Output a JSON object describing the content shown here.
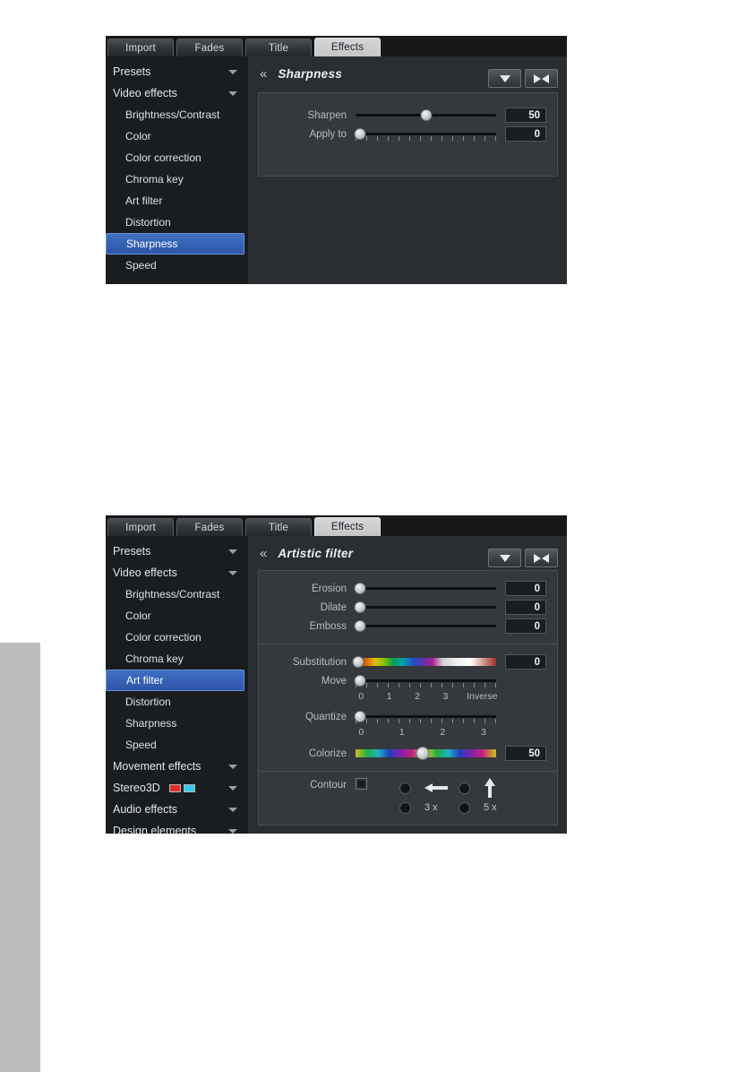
{
  "tabs": [
    {
      "label": "Import",
      "active": false
    },
    {
      "label": "Fades",
      "active": false
    },
    {
      "label": "Title",
      "active": false
    },
    {
      "label": "Effects",
      "active": true
    }
  ],
  "sidebar_sharpness": {
    "items": [
      {
        "label": "Presets",
        "type": "group",
        "caret": true
      },
      {
        "label": "Video effects",
        "type": "group",
        "caret": true
      },
      {
        "label": "Brightness/Contrast",
        "type": "child"
      },
      {
        "label": "Color",
        "type": "child"
      },
      {
        "label": "Color correction",
        "type": "child"
      },
      {
        "label": "Chroma key",
        "type": "child"
      },
      {
        "label": "Art filter",
        "type": "child"
      },
      {
        "label": "Distortion",
        "type": "child"
      },
      {
        "label": "Sharpness",
        "type": "child",
        "selected": true
      },
      {
        "label": "Speed",
        "type": "child"
      }
    ]
  },
  "sidebar_artistic": {
    "items": [
      {
        "label": "Presets",
        "type": "group",
        "caret": true
      },
      {
        "label": "Video effects",
        "type": "group",
        "caret": true
      },
      {
        "label": "Brightness/Contrast",
        "type": "child"
      },
      {
        "label": "Color",
        "type": "child"
      },
      {
        "label": "Color correction",
        "type": "child"
      },
      {
        "label": "Chroma key",
        "type": "child"
      },
      {
        "label": "Art filter",
        "type": "child",
        "selected": true
      },
      {
        "label": "Distortion",
        "type": "child"
      },
      {
        "label": "Sharpness",
        "type": "child"
      },
      {
        "label": "Speed",
        "type": "child"
      },
      {
        "label": "Movement effects",
        "type": "group",
        "caret": true
      },
      {
        "label": "Stereo3D",
        "type": "group",
        "caret": true,
        "icon": "3d-glasses-icon"
      },
      {
        "label": "Audio effects",
        "type": "group",
        "caret": true
      },
      {
        "label": "Design elements",
        "type": "group",
        "caret": true
      }
    ]
  },
  "panel_sharpness": {
    "title": "Sharpness",
    "back_icon": "«",
    "buttons": {
      "dropdown_icon": "triangle-down-icon",
      "reset_icon": "reset-arrows-icon"
    },
    "controls": [
      {
        "label": "Sharpen",
        "value": "50",
        "percent": 50,
        "track": "plain"
      },
      {
        "label": "Apply to",
        "value": "0",
        "percent": 3,
        "track": "plain",
        "ticks_plain": true
      }
    ]
  },
  "panel_artistic": {
    "title": "Artistic filter",
    "back_icon": "«",
    "buttons": {
      "dropdown_icon": "triangle-down-icon",
      "reset_icon": "reset-arrows-icon"
    },
    "group1": [
      {
        "label": "Erosion",
        "value": "0",
        "percent": 3,
        "track": "plain"
      },
      {
        "label": "Dilate",
        "value": "0",
        "percent": 3,
        "track": "plain"
      },
      {
        "label": "Emboss",
        "value": "0",
        "percent": 3,
        "track": "plain"
      }
    ],
    "group2": {
      "substitution": {
        "label": "Substitution",
        "value": "0",
        "percent": 2,
        "track": "rainbow"
      },
      "move": {
        "label": "Move",
        "percent": 3,
        "track": "plain",
        "tick_labels": [
          "0",
          "1",
          "2",
          "3",
          "Inverse"
        ],
        "tick_positions": [
          4,
          24,
          44,
          64,
          90
        ]
      },
      "quantize": {
        "label": "Quantize",
        "percent": 3,
        "track": "plain",
        "tick_labels": [
          "0",
          "1",
          "2",
          "3"
        ],
        "tick_positions": [
          4,
          33,
          62,
          91
        ]
      },
      "colorize": {
        "label": "Colorize",
        "value": "50",
        "percent": 48,
        "track": "rainbow2"
      }
    },
    "contour": {
      "label": "Contour",
      "checkbox_checked": true,
      "options": [
        {
          "icon": "arrow-left-icon",
          "label": ""
        },
        {
          "icon": "arrow-up-icon",
          "label": ""
        },
        {
          "icon": "",
          "label": "3 x"
        },
        {
          "icon": "",
          "label": "5 x"
        }
      ]
    }
  },
  "colors": {
    "panel_bg": "#1d2023",
    "content_bg": "#2a2d31",
    "group_bg": "#35383c",
    "selection_blue": "#2e55a8",
    "text": "#e3e6e9",
    "glasses_left": "#d93025",
    "glasses_right": "#37c7e8"
  }
}
